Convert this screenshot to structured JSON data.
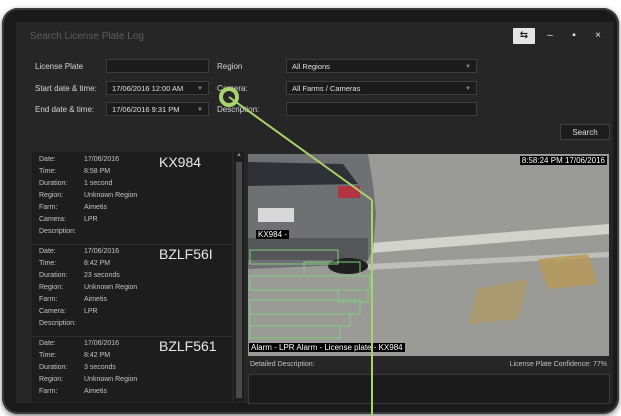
{
  "window": {
    "title": "Search License Plate Log",
    "buttons": {
      "swap_icon": "⇆",
      "minimize": "–",
      "maximize": "▪",
      "close": "×"
    }
  },
  "filters": {
    "license_plate_label": "License Plate",
    "license_plate_value": "",
    "region_label": "Region",
    "region_value": "All Regions",
    "start_label": "Start date & time:",
    "start_value": "17/06/2016 12:00 AM",
    "camera_label": "Camera:",
    "camera_value": "All Farms / Cameras",
    "end_label": "End date & time:",
    "end_value": "17/06/2016 9:31 PM",
    "description_label": "Description:",
    "description_value": "",
    "search_label": "Search"
  },
  "results": [
    {
      "plate": "KX984",
      "date": "17/06/2016",
      "time": "8:58 PM",
      "duration": "1 second",
      "region": "Unknown Region",
      "farm": "Aimetis",
      "camera": "LPR",
      "description": ""
    },
    {
      "plate": "BZLF56I",
      "date": "17/06/2016",
      "time": "8:42 PM",
      "duration": "23 seconds",
      "region": "Unknown Region",
      "farm": "Aimetis",
      "camera": "LPR",
      "description": ""
    },
    {
      "plate": "BZLF561",
      "date": "17/06/2016",
      "time": "8:42 PM",
      "duration": "3 seconds",
      "region": "Unknown Region",
      "farm": "Aimetis",
      "camera": "",
      "description": ""
    }
  ],
  "row_labels": {
    "date": "Date:",
    "time": "Time:",
    "duration": "Duration:",
    "region": "Region:",
    "farm": "Farm:",
    "camera": "Camera:",
    "description": "Description:"
  },
  "video": {
    "timestamp": "8:58:24 PM 17/06/2016",
    "plate_tag": "KX984 -",
    "alarm_text": "Alarm - LPR Alarm - License plate - KX984"
  },
  "details": {
    "detailed_description_label": "Detailed Description:",
    "confidence_label": "License Plate Confidence: 77%"
  },
  "colors": {
    "callout": "#a9d36b",
    "background": "#262626",
    "bezel": "#1a1a1a"
  }
}
